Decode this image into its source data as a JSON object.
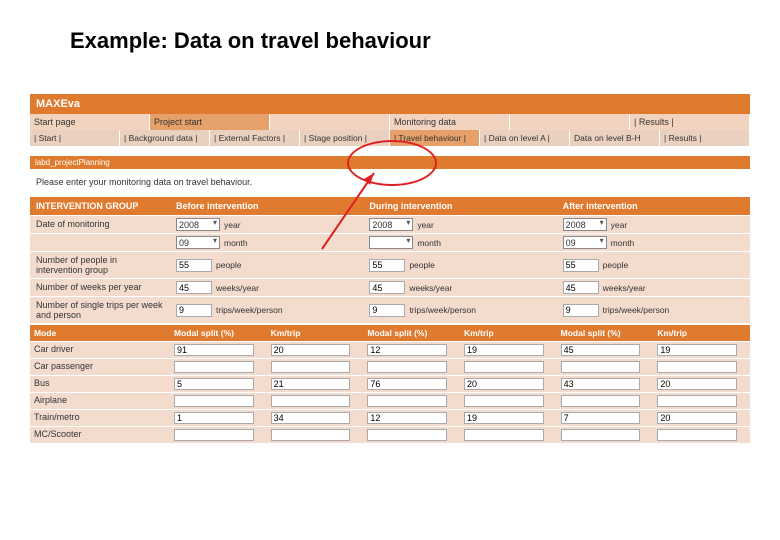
{
  "slide_title": "Example: Data on travel behaviour",
  "app_title": "MAXEva",
  "tabs_level1": [
    {
      "label": "Start page",
      "active": false
    },
    {
      "label": "Project start",
      "active": true
    },
    {
      "label": "",
      "active": false
    },
    {
      "label": "Monitoring data",
      "active": false
    },
    {
      "label": "",
      "active": false
    },
    {
      "label": "| Results |",
      "active": false
    }
  ],
  "tabs_level2": [
    {
      "label": "| Start |",
      "active": false
    },
    {
      "label": "| Background data |",
      "active": false
    },
    {
      "label": "| External Factors |",
      "active": false
    },
    {
      "label": "| Stage position |",
      "active": false
    },
    {
      "label": "| Travel behaviour |",
      "active": true
    },
    {
      "label": "| Data on level A |",
      "active": false
    },
    {
      "label": "Data on level B-H",
      "active": false
    },
    {
      "label": "| Results |",
      "active": false
    }
  ],
  "form_label": "labd_projectPlanning",
  "instruction_text": "Please enter your monitoring data on travel behaviour.",
  "periods": {
    "header_first": "INTERVENTION GROUP",
    "labels": [
      "Before intervention",
      "During intervention",
      "After intervention"
    ]
  },
  "rows": [
    {
      "label": "Date of monitoring",
      "type": "year-month",
      "values": [
        {
          "year": "2008",
          "month": "09"
        },
        {
          "year": "2008",
          "month": ""
        },
        {
          "year": "2008",
          "month": "09"
        }
      ],
      "units": [
        "year",
        "month"
      ]
    },
    {
      "label": "Number of people in intervention group",
      "type": "num",
      "unit": "people",
      "values": [
        "55",
        "55",
        "55"
      ]
    },
    {
      "label": "Number of weeks per year",
      "type": "num",
      "unit": "weeks/year",
      "values": [
        "45",
        "45",
        "45"
      ]
    },
    {
      "label": "Number of single trips per week and person",
      "type": "num",
      "unit": "trips/week/person",
      "values": [
        "9",
        "9",
        "9"
      ]
    }
  ],
  "mode_header_first": "Mode",
  "mode_cols": [
    "Modal split (%)",
    "Km/trip",
    "Modal split (%)",
    "Km/trip",
    "Modal split (%)",
    "Km/trip"
  ],
  "modes": [
    {
      "label": "Car driver",
      "vals": [
        "91",
        "20",
        "12",
        "19",
        "45",
        "19"
      ]
    },
    {
      "label": "Car passenger",
      "vals": [
        "",
        "",
        "",
        "",
        "",
        ""
      ]
    },
    {
      "label": "Bus",
      "vals": [
        "5",
        "21",
        "76",
        "20",
        "43",
        "20"
      ]
    },
    {
      "label": "Airplane",
      "vals": [
        "",
        "",
        "",
        "",
        "",
        ""
      ]
    },
    {
      "label": "Train/metro",
      "vals": [
        "1",
        "34",
        "12",
        "19",
        "7",
        "20"
      ]
    },
    {
      "label": "MC/Scooter",
      "vals": [
        "",
        "",
        "",
        "",
        "",
        ""
      ]
    }
  ]
}
